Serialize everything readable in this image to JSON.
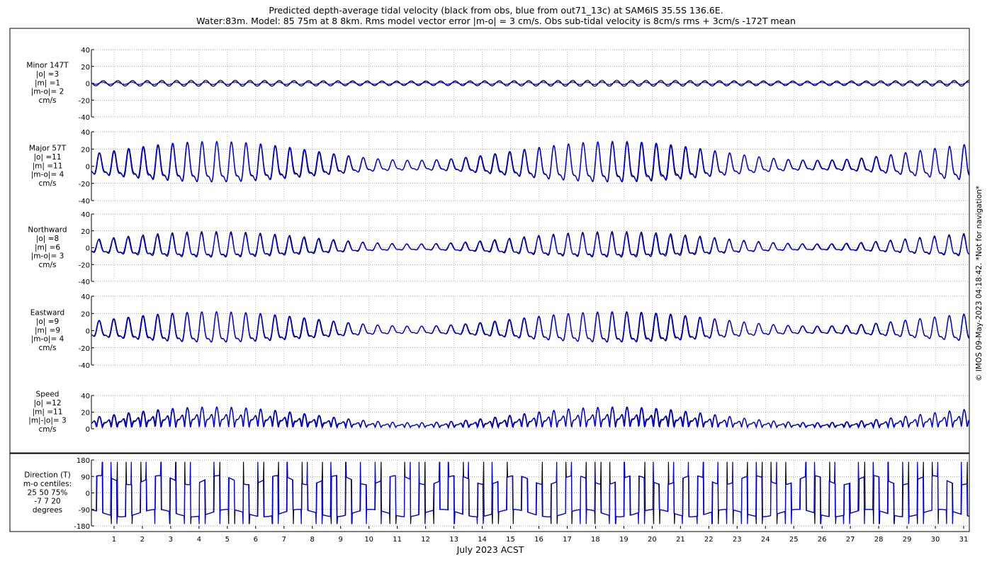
{
  "title_line1": "Predicted depth-average tidal velocity (black from obs, blue from out71_13c) at SAM6IS 35.5S 136.6E.",
  "title_line2": "Water:83m. Model: 85 75m at 8 8km. Rms model vector error |m-o| = 3 cm/s. Obs sub-tidal velocity is 8cm/s rms + 3cm/s -172T mean",
  "xlabel": "July 2023 ACST",
  "copyright": "© IMOS 09-May-2023 04:18:42. *Not for navigation*",
  "colors": {
    "obs": "#000000",
    "model": "#0000ff",
    "grid": "#999999"
  },
  "chart_data": {
    "type": "line",
    "x_ticks": [
      "1",
      "2",
      "3",
      "4",
      "5",
      "6",
      "7",
      "8",
      "9",
      "10",
      "11",
      "12",
      "13",
      "14",
      "15",
      "16",
      "17",
      "18",
      "19",
      "20",
      "21",
      "22",
      "23",
      "24",
      "25",
      "26",
      "27",
      "28",
      "29",
      "30",
      "31"
    ],
    "x_range": [
      0.2,
      31.2
    ],
    "series_names": [
      "obs",
      "out71_13c"
    ],
    "panels": [
      {
        "id": "minor",
        "label": [
          "Minor 147T",
          "|o| =3",
          "|m| =1",
          "|m-o|= 2",
          "cm/s"
        ],
        "ylim": [
          -40,
          40
        ],
        "yticks": [
          "-40",
          "-20",
          "0",
          "20",
          "40"
        ]
      },
      {
        "id": "major",
        "label": [
          "Major 57T",
          "|o| =11",
          "|m| =11",
          "|m-o|= 4",
          "cm/s"
        ],
        "ylim": [
          -40,
          40
        ],
        "yticks": [
          "-40",
          "-20",
          "0",
          "20",
          "40"
        ]
      },
      {
        "id": "north",
        "label": [
          "Northward",
          "|o| =8",
          "|m| =6",
          "|m-o|= 3",
          "cm/s"
        ],
        "ylim": [
          -40,
          40
        ],
        "yticks": [
          "-40",
          "-20",
          "0",
          "20",
          "40"
        ]
      },
      {
        "id": "east",
        "label": [
          "Eastward",
          "|o| =9",
          "|m| =9",
          "|m-o|= 4",
          "cm/s"
        ],
        "ylim": [
          -40,
          40
        ],
        "yticks": [
          "-40",
          "-20",
          "0",
          "20",
          "40"
        ]
      },
      {
        "id": "speed",
        "label": [
          "Speed",
          "|o| =12",
          "|m| =11",
          "|m|-|o|= 3",
          "cm/s"
        ],
        "ylim": [
          0,
          40
        ],
        "yticks": [
          "0",
          "20",
          "40"
        ]
      },
      {
        "id": "dir",
        "label": [
          "Direction (T)",
          "m-o centiles:",
          "25  50  75%",
          "-7   7  20",
          "degrees"
        ],
        "ylim": [
          -180,
          180
        ],
        "yticks": [
          "-180",
          "-90",
          "0",
          "90",
          "180"
        ]
      }
    ]
  }
}
